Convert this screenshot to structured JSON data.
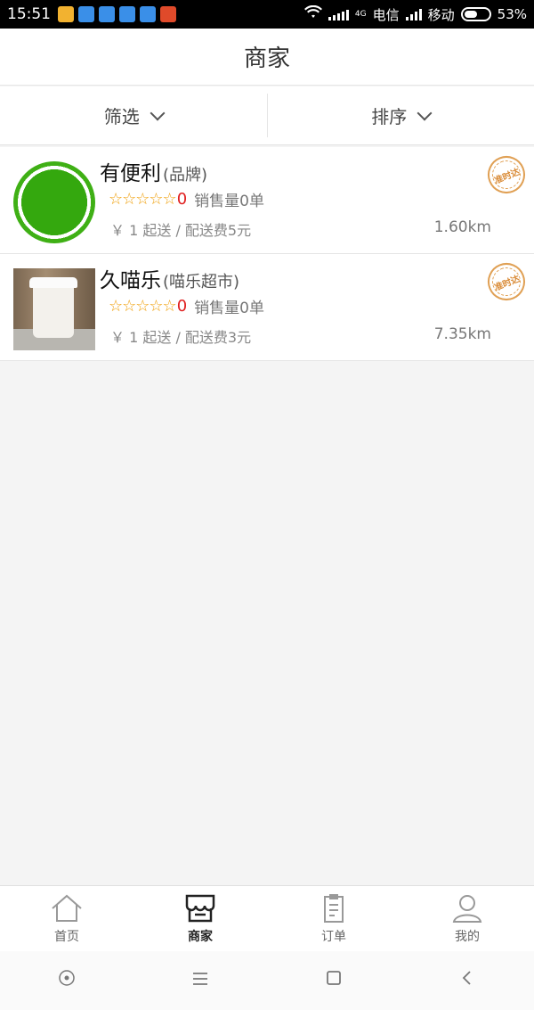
{
  "statusbar": {
    "time": "15:51",
    "network_type": "4G",
    "carrier1": "电信",
    "carrier2": "移动",
    "battery": "53%",
    "app_icon_colors": [
      "#f2b230",
      "#3a8fe8",
      "#3a8fe8",
      "#3a8fe8",
      "#3a8fe8",
      "#e04a2a"
    ]
  },
  "header": {
    "title": "商家"
  },
  "filters": {
    "filter_label": "筛选",
    "sort_label": "排序"
  },
  "merchants": [
    {
      "name": "有便利",
      "tag": "(品牌)",
      "stars": "☆☆☆☆☆",
      "score": "0",
      "sales": "销售量0单",
      "delivery": "￥ 1 起送 / 配送费5元",
      "distance": "1.60km",
      "badge": "准时达",
      "thumbnail": "green-circle-logo"
    },
    {
      "name": "久喵乐",
      "tag": "(喵乐超市)",
      "stars": "☆☆☆☆☆",
      "score": "0",
      "sales": "销售量0单",
      "delivery": "￥ 1 起送 / 配送费3元",
      "distance": "7.35km",
      "badge": "准时达",
      "thumbnail": "coffee-cup-photo"
    }
  ],
  "tabs": [
    {
      "label": "首页",
      "icon": "home-icon",
      "active": false
    },
    {
      "label": "商家",
      "icon": "store-icon",
      "active": true
    },
    {
      "label": "订单",
      "icon": "clipboard-icon",
      "active": false
    },
    {
      "label": "我的",
      "icon": "user-icon",
      "active": false
    }
  ],
  "navbar": {
    "icons": [
      "circle-icon",
      "menu-icon",
      "square-icon",
      "back-icon"
    ]
  },
  "colors": {
    "star": "#f0a10e",
    "score": "#e02020",
    "badge": "#d98a35",
    "background": "#f4f4f4"
  }
}
